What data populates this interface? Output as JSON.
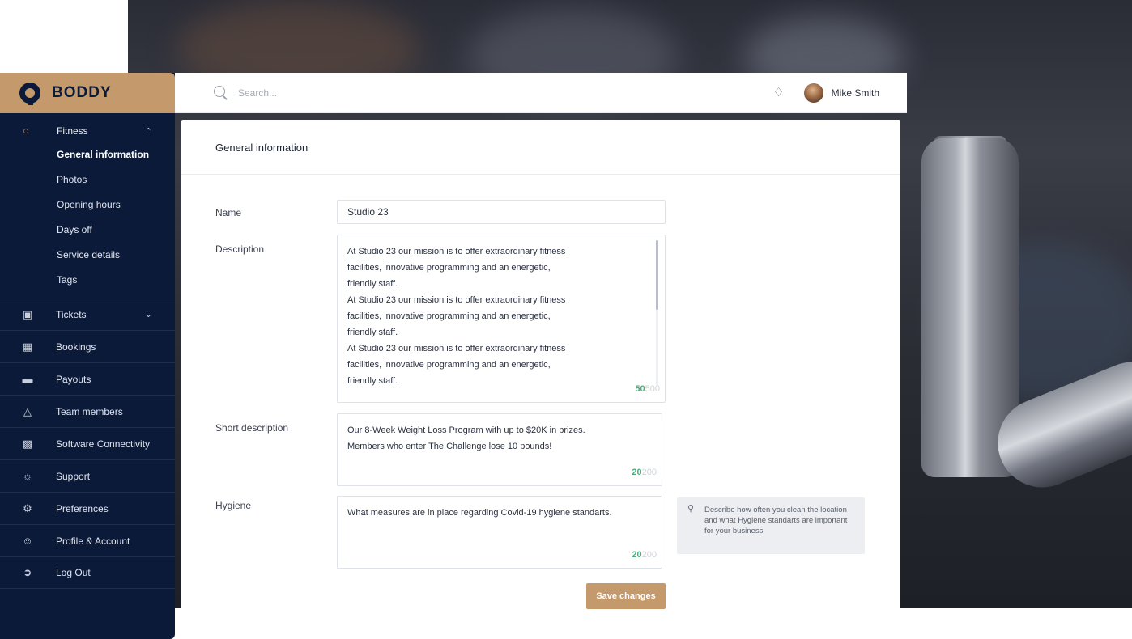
{
  "colors": {
    "brand": "#c49a6c",
    "sidebar": "#0c1a3a",
    "counter_green": "#48b07a"
  },
  "brand": {
    "name": "BODDY",
    "icon": "boddy-logo-icon"
  },
  "search": {
    "placeholder": "Search..."
  },
  "user": {
    "name": "Mike Smith",
    "icon": "bell-icon"
  },
  "sidebar": {
    "fitness": {
      "label": "Fitness",
      "icon": "dumbbell-icon",
      "expanded": true,
      "items": [
        {
          "label": "General information",
          "active": true
        },
        {
          "label": "Photos"
        },
        {
          "label": "Opening hours"
        },
        {
          "label": "Days off"
        },
        {
          "label": "Service details"
        },
        {
          "label": "Tags"
        }
      ]
    },
    "items": [
      {
        "label": "Tickets",
        "icon": "ticket-icon",
        "has_chevron": true
      },
      {
        "label": "Bookings",
        "icon": "calendar-icon"
      },
      {
        "label": "Payouts",
        "icon": "cash-icon"
      },
      {
        "label": "Team members",
        "icon": "team-icon"
      },
      {
        "label": "Software Connectivity",
        "icon": "monitor-icon"
      },
      {
        "label": "Support",
        "icon": "headset-icon"
      },
      {
        "label": "Preferences",
        "icon": "gear-icon"
      },
      {
        "label": "Profile & Account",
        "icon": "user-circle-icon"
      },
      {
        "label": "Log Out",
        "icon": "logout-icon"
      }
    ]
  },
  "form": {
    "title": "General information",
    "name": {
      "label": "Name",
      "value": "Studio 23"
    },
    "description": {
      "label": "Description",
      "value": "At Studio 23 our mission is to offer extraordinary fitness\nfacilities, innovative programming and an energetic,\nfriendly staff.\nAt Studio 23 our mission is to offer extraordinary fitness\nfacilities, innovative programming and an energetic,\nfriendly staff.\nAt Studio 23 our mission is to offer extraordinary fitness\nfacilities, innovative programming and an energetic,\nfriendly staff.",
      "count": "50",
      "max": "500"
    },
    "short_description": {
      "label": "Short description",
      "value": "Our 8-Week Weight Loss Program with up to $20K in prizes.\nMembers who enter The Challenge lose 10 pounds!",
      "count": "20",
      "max": "200"
    },
    "hygiene": {
      "label": "Hygiene",
      "value": "What measures are in place regarding Covid-19 hygiene standarts.",
      "count": "20",
      "max": "200",
      "tip": "Describe how often you clean the location and what Hygiene standarts are important for your business"
    },
    "save_label": "Save changes"
  }
}
